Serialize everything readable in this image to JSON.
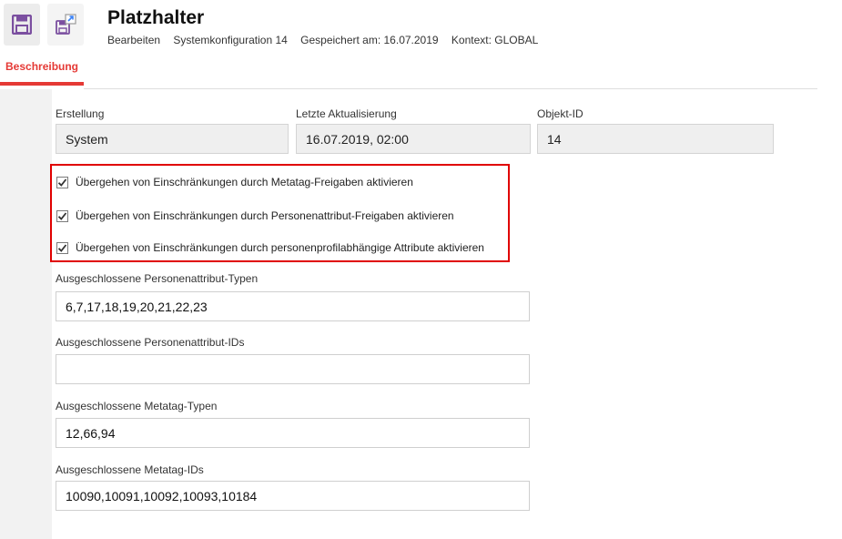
{
  "header": {
    "title": "Platzhalter",
    "meta": {
      "action": "Bearbeiten",
      "config": "Systemkonfiguration 14",
      "saved": "Gespeichert am: 16.07.2019",
      "context": "Kontext: GLOBAL"
    }
  },
  "toolbar": {
    "save_icon": "save-icon",
    "saveas_icon": "save-as-icon"
  },
  "tabs": {
    "active": "Beschreibung"
  },
  "colors": {
    "accent": "#e53935",
    "highlight": "#e00000",
    "icon": "#7b4fa0"
  },
  "info": {
    "created_label": "Erstellung",
    "created_value": "System",
    "updated_label": "Letzte Aktualisierung",
    "updated_value": "16.07.2019, 02:00",
    "id_label": "Objekt-ID",
    "id_value": "14"
  },
  "checkboxes": [
    {
      "label": "Übergehen von Einschränkungen durch Metatag-Freigaben aktivieren",
      "checked": true
    },
    {
      "label": "Übergehen von Einschränkungen durch Personenattribut-Freigaben aktivieren",
      "checked": true
    },
    {
      "label": "Übergehen von Einschränkungen durch personenprofilabhängige Attribute aktivieren",
      "checked": true
    }
  ],
  "fields": {
    "person_attr_types_label": "Ausgeschlossene Personenattribut-Typen",
    "person_attr_types_value": "6,7,17,18,19,20,21,22,23",
    "person_attr_ids_label": "Ausgeschlossene Personenattribut-IDs",
    "person_attr_ids_value": "",
    "metatag_types_label": "Ausgeschlossene Metatag-Typen",
    "metatag_types_value": "12,66,94",
    "metatag_ids_label": "Ausgeschlossene Metatag-IDs",
    "metatag_ids_value": "10090,10091,10092,10093,10184"
  }
}
